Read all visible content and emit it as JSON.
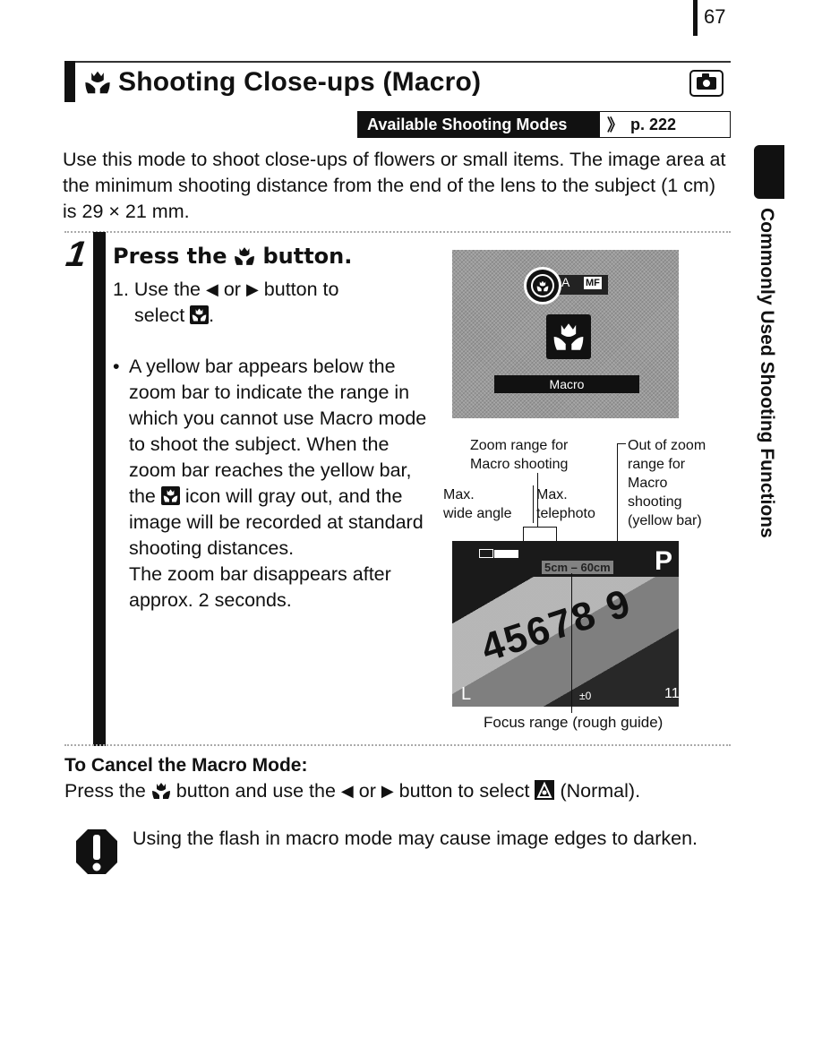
{
  "page": {
    "number": "67"
  },
  "header": {
    "title": "Shooting Close-ups (Macro)",
    "title_icon": "macro-tulip-icon",
    "mode_icon": "camera-icon",
    "available_modes_label": "Available Shooting Modes",
    "available_modes_ref": "p. 222",
    "ref_arrow_glyph": "》"
  },
  "intro": "Use this mode to shoot close-ups of flowers or small items. The image area at the minimum shooting distance from the end of the lens to the subject (1 cm) is 29 × 21 mm.",
  "step": {
    "number": "1",
    "title_before": "Press the",
    "title_after": "button.",
    "substep_number": "1.",
    "substep_line1_a": "Use the",
    "substep_or": "or",
    "substep_line1_b": "button to",
    "substep_line2": "select",
    "substep_line2_end": ".",
    "bullet": "•",
    "bullet_a": "A yellow bar appears below the zoom bar to indicate the range in which you cannot use Macro mode to shoot the subject. When the zoom bar reaches the yellow bar, the",
    "bullet_b": "icon will gray out, and the image will be recorded at standard shooting distances.",
    "bullet_c": "The zoom bar disappears after approx. 2 seconds."
  },
  "screen_top": {
    "mode_A": "A",
    "mode_MF": "MF",
    "selected_label": "Macro"
  },
  "screen_bottom": {
    "mode": "P",
    "focus_range": "5cm – 60cm",
    "digits": "45678 9",
    "image_size": "L",
    "exposure_comp": "±0",
    "shots_remaining": "11"
  },
  "annotations": {
    "zoom_range": "Zoom range for\nMacro shooting",
    "zoom_range_l1": "Zoom range for",
    "zoom_range_l2": "Macro shooting",
    "out_of_range_l1": "Out of zoom",
    "out_of_range_l2": "range for",
    "out_of_range_l3": "Macro",
    "out_of_range_l4": "shooting",
    "out_of_range_l5": "(yellow bar)",
    "max_wide_l1": "Max.",
    "max_wide_l2": "wide angle",
    "max_tele_l1": "Max.",
    "max_tele_l2": "telephoto",
    "focus_range": "Focus range (rough guide)"
  },
  "side_tab": {
    "label": "Commonly Used Shooting Functions"
  },
  "cancel": {
    "title": "To Cancel the Macro Mode:",
    "text_a": "Press the",
    "text_b": "button and use the",
    "text_or": "or",
    "text_c": "button to select",
    "text_d": "(Normal)."
  },
  "caution": {
    "icon": "caution-icon",
    "text": "Using the flash in macro mode may cause image edges to darken."
  },
  "glyphs": {
    "left_arrow": "⬅",
    "right_arrow": "➡"
  }
}
